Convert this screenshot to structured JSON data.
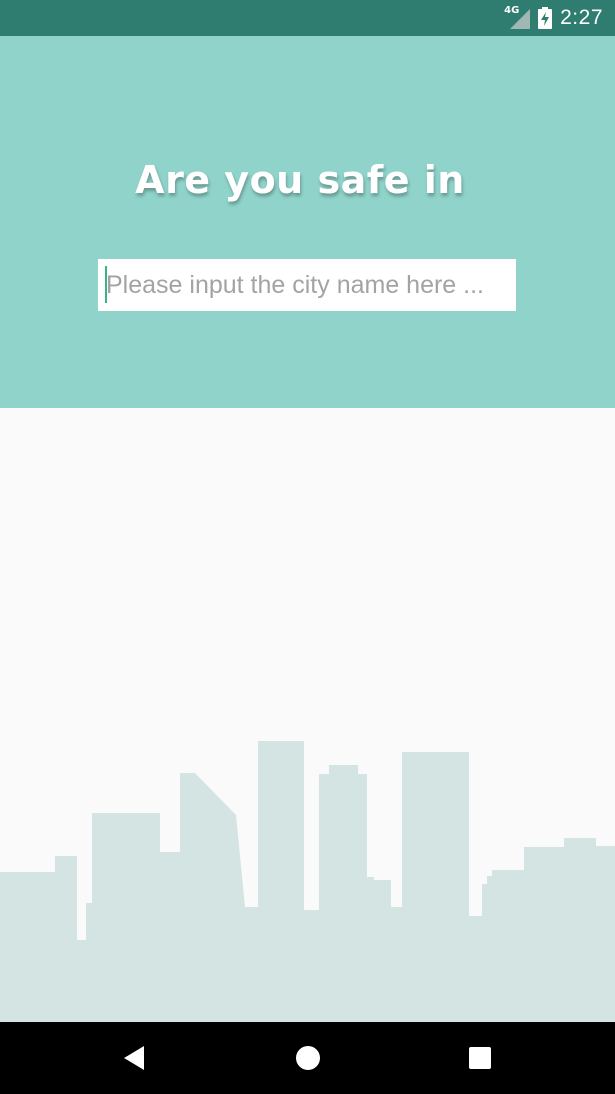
{
  "status_bar": {
    "network_label": "4G",
    "time": "2:27",
    "icons": [
      "signal-icon",
      "battery-charging-icon"
    ]
  },
  "header": {
    "title": "Are you safe in",
    "city_input": {
      "value": "",
      "placeholder": "Please input the city name here ..."
    }
  },
  "nav_bar": {
    "icons": [
      "back-icon",
      "home-icon",
      "recents-icon"
    ]
  },
  "colors": {
    "status_bar": "#2e7d70",
    "header_background": "#8fd3ca",
    "page_background": "#fafafa",
    "skyline": "#d4e4e2",
    "accent": "#3bb38a",
    "nav_bar": "#000000"
  }
}
